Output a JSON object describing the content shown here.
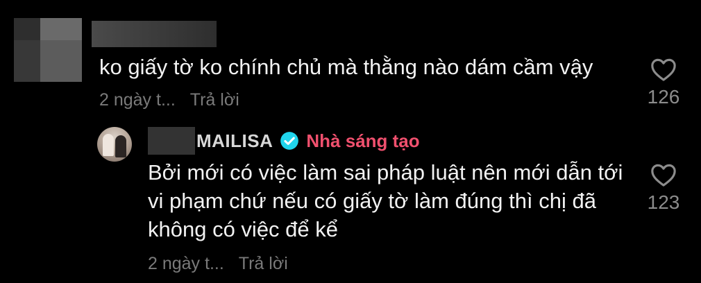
{
  "comment": {
    "text": "ko giấy tờ ko chính chủ mà thằng nào dám cầm vậy",
    "time": "2 ngày t...",
    "reply_label": "Trả lời",
    "likes": "126"
  },
  "reply": {
    "username": "MAILISA",
    "badge": "Nhà sáng tạo",
    "text": "Bởi mới có việc làm sai pháp luật nên mới dẫn tới vi phạm chứ nếu có giấy tờ làm đúng thì chị đã không có việc để kể",
    "time": "2 ngày t...",
    "reply_label": "Trả lời",
    "likes": "123"
  },
  "icons": {
    "like": "heart-outline-icon",
    "verified": "verified-check-icon"
  },
  "colors": {
    "background": "#000000",
    "text": "#f2f2f2",
    "muted": "#7a7a7a",
    "creator_badge": "#f0506e",
    "verified": "#20d5ec"
  }
}
